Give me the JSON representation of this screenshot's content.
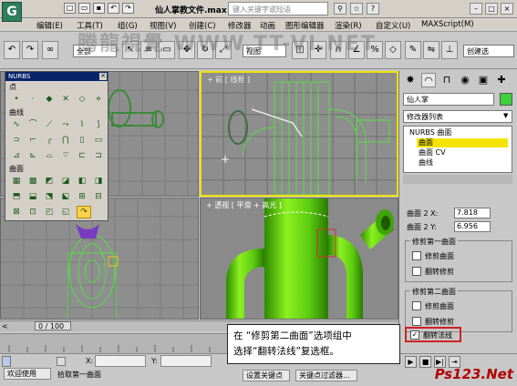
{
  "titlebar": {
    "title": "仙人掌教文件.max",
    "search_placeholder": "键入关键字或短语"
  },
  "menu": [
    "编辑(E)",
    "工具(T)",
    "组(G)",
    "视图(V)",
    "创建(C)",
    "修改器",
    "动画",
    "图形编辑器",
    "渲染(R)",
    "自定义(U)",
    "MAXScript(M)"
  ],
  "toolbar": {
    "selection_filter": "全部",
    "ref_coord": "视图",
    "selset_label": "创建选"
  },
  "watermark": "腾龍視覺 WWW.TT-VI.NET",
  "viewports": {
    "top_right_label": "+ 前 [ 线框 ]",
    "bottom_right_label": "+ 透视 [ 平滑 + 高光 ]"
  },
  "nurbs_panel": {
    "title": "NURBS",
    "sections": [
      "点",
      "曲线",
      "曲面"
    ]
  },
  "command_panel": {
    "object_name": "仙人掌",
    "modifier_list": "修改器列表",
    "stack": [
      "NURBS 曲面",
      "曲面",
      "曲面 CV",
      "曲线"
    ],
    "surface_2x_label": "曲面 2 X:",
    "surface_2x_value": "7.818",
    "surface_2y_label": "曲面 2 Y:",
    "surface_2y_value": "6.956",
    "group1_title": "修剪第一曲面",
    "group1_trim": "修剪曲面",
    "group1_flip": "翻转修剪",
    "group2_title": "修剪第二曲面",
    "group2_trim": "修剪曲面",
    "group2_flip": "翻转修剪",
    "flip_normals": "翻转法线"
  },
  "timeline": {
    "position": "0 / 100"
  },
  "status": {
    "welcome": "欢迎使用",
    "prompt": "拾取第一曲面",
    "x_label": "X:",
    "y_label": "Y:",
    "set_key": "设置关键点",
    "key_filters": "关键点过滤器..."
  },
  "callout": {
    "line1": "在 “修剪第二曲面”选项组中",
    "line2": "选择“翻转法线”复选框。"
  },
  "brand_logo": "Ps123.Net"
}
